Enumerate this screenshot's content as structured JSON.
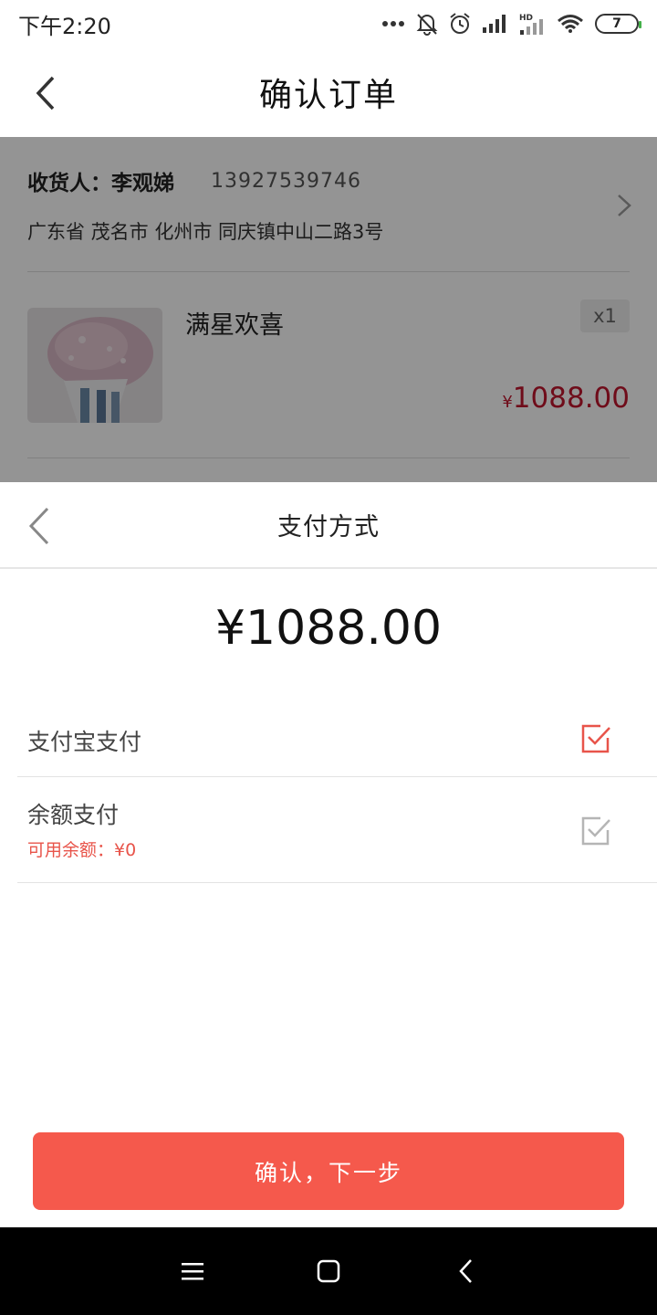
{
  "status_bar": {
    "time": "下午2:20",
    "battery": "7"
  },
  "header": {
    "title": "确认订单"
  },
  "order": {
    "consignee": "收货人：李观娣",
    "phone": "13927539746",
    "address": "广东省 茂名市 化州市 同庆镇中山二路3号",
    "product": {
      "name": "满星欢喜",
      "quantity": "x1",
      "price_symbol": "¥",
      "price": "1088.00"
    }
  },
  "payment": {
    "title": "支付方式",
    "amount": "¥1088.00",
    "methods": [
      {
        "label": "支付宝支付",
        "selected": true
      },
      {
        "label": "余额支付",
        "sub": "可用余额：¥0",
        "selected": false
      }
    ],
    "confirm_label": "确认，下一步"
  },
  "colors": {
    "accent": "#f5594c",
    "price": "#c0162d",
    "selected_check": "#e8544a",
    "unselected_check": "#b5b5b5",
    "overlay": "#000000"
  },
  "icons": {
    "status": [
      "more-icon",
      "mute-icon",
      "alarm-icon",
      "signal-icon",
      "hd-signal-icon",
      "wifi-icon",
      "battery-icon"
    ],
    "nav": [
      "menu-icon",
      "home-icon",
      "back-icon"
    ]
  }
}
